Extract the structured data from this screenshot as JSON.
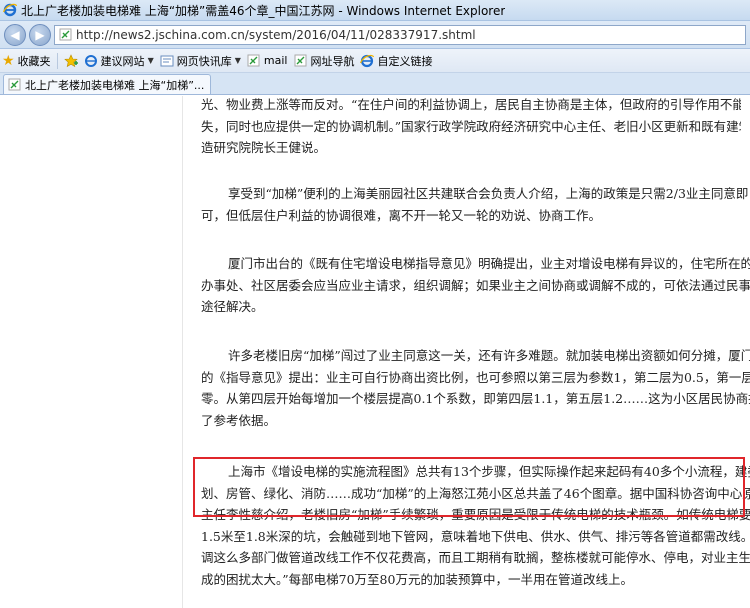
{
  "window": {
    "title": "北上广老楼加装电梯难 上海“加梯”需盖46个章_中国江苏网 - Windows Internet Explorer"
  },
  "address": {
    "url": "http://news2.jschina.com.cn/system/2016/04/11/028337917.shtml"
  },
  "favorites": {
    "favorites_label": "收藏夹",
    "items": [
      "建议网站",
      "网页快讯库",
      "mail",
      "网址导航",
      "自定义链接"
    ]
  },
  "tab": {
    "label": "北上广老楼加装电梯难 上海“加梯”..."
  },
  "article": {
    "paragraphs": [
      {
        "lines": [
          "光、物业费上涨等而反对。“在住户间的利益协调上，居民自主协商是主体，但政府的引导作用不能缺",
          "失，同时也应提供一定的协调机制。”国家行政学院政府经济研究中心主任、老旧小区更新和既有建筑改",
          "造研究院院长王健说。"
        ]
      },
      {
        "lines": [
          "享受到“加梯”便利的上海美丽园社区共建联合会负责人介绍，上海的政策是只需2/3业主同意即",
          "可，但低层住户利益的协调很难，离不开一轮又一轮的劝说、协商工作。"
        ]
      },
      {
        "lines": [
          "厦门市出台的《既有住宅增设电梯指导意见》明确提出，业主对增设电梯有异议的，住宅所在的街道",
          "办事处、社区居委会应当应业主请求，组织调解；如果业主之间协商或调解不成的，可依法通过民事诉讼",
          "途径解决。"
        ]
      },
      {
        "lines": [
          "许多老楼旧房“加梯”闯过了业主同意这一关，还有许多难题。就加装电梯出资额如何分摊，厦门市",
          "的《指导意见》提出：业主可自行协商出资比例，也可参照以第三层为参数1，第二层为0.5，第一层为",
          "零。从第四层开始每增加一个楼层提高0.1个系数，即第四层1.1，第五层1.2……这为小区居民协商提供",
          "了参考依据。"
        ]
      },
      {
        "lines": [
          "上海市《增设电梯的实施流程图》总共有13个步骤，但实际操作起来起码有40多个小流程，建委、规",
          "划、房管、绿化、消防……成功“加梯”的上海怒江苑小区总共盖了46个图章。据中国科协咨询中心原副",
          "主任李性慈介绍，老楼旧房“加梯”手续繁琐，重要原因是受限于传统电梯的技术瓶颈。如传统电梯要挖",
          "1.5米至1.8米深的坑，会触碰到地下管网，意味着地下供电、供水、供气、排污等各管道都需改线。“协",
          "调这么多部门做管道改线工作不仅花费高，而且工期稍有耽搁，整栋楼就可能停水、停电，对业主生活造",
          "成的困扰太大。”每部电梯70万至80万元的加装预算中，一半用在管道改线上。"
        ]
      }
    ]
  }
}
